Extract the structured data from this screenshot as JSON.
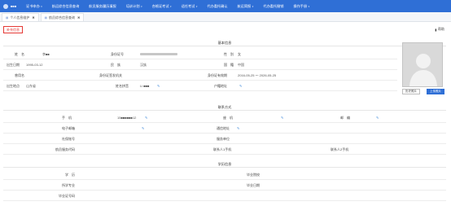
{
  "nav": {
    "brand_name": "■■■",
    "items": [
      {
        "label": "证书申办",
        "caret": "▾"
      },
      {
        "label": "航运综合信息查询",
        "caret": ""
      },
      {
        "label": "航员服务履历填报",
        "caret": ""
      },
      {
        "label": "培训计划",
        "caret": "▾"
      },
      {
        "label": "合格证考试",
        "caret": "▾"
      },
      {
        "label": "适任考试",
        "caret": "▾"
      },
      {
        "label": "代办委托确认",
        "caret": ""
      },
      {
        "label": "航运简报",
        "caret": "▾"
      },
      {
        "label": "代办委托撤销",
        "caret": ""
      },
      {
        "label": "操作手册",
        "caret": "▾"
      }
    ]
  },
  "tabs": [
    {
      "label": "个人信息维护",
      "close": "✖"
    },
    {
      "label": "航员综合信息查询",
      "close": "✖"
    }
  ],
  "toolbar": {
    "auth_label": "补充信息",
    "help_label": "帮助",
    "help_icon": "book-icon"
  },
  "basic": {
    "title": "基本信息",
    "rows": [
      [
        {
          "label": "姓　名",
          "value": "李■■"
        },
        {
          "label": "身份证号",
          "value": ""
        },
        {
          "label": "性　别",
          "value": "女"
        }
      ],
      [
        {
          "label": "出生日期",
          "value": "1995-03-12"
        },
        {
          "label": "民　族",
          "value": "汉族"
        },
        {
          "label": "国　籍",
          "value": "中国"
        }
      ],
      [
        {
          "label": "曾用名",
          "value": ""
        },
        {
          "label": "身份证签发机关",
          "value": ""
        },
        {
          "label": "身份证有效期",
          "value": "2016-05-25 ～ 2026-05-25"
        }
      ],
      [
        {
          "label": "出生地点",
          "value": "山东省"
        },
        {
          "label": "姓名拼音",
          "value": "Li ■■■"
        },
        {
          "label": "户籍地址",
          "value": ""
        }
      ]
    ]
  },
  "photo": {
    "view_label": "历史照片",
    "upload_label": "上传照片"
  },
  "contact": {
    "title": "联系方式",
    "rows": [
      [
        {
          "label": "手　机",
          "value": "15■■■■■■12"
        },
        {
          "label": "座　机",
          "value": ""
        },
        {
          "label": "邮　编",
          "value": ""
        }
      ],
      [
        {
          "label": "电子邮箱",
          "value": ""
        },
        {
          "label": "通信地址",
          "value": ""
        }
      ],
      [
        {
          "label": "社保账号",
          "value": ""
        },
        {
          "label": "服务单位",
          "value": ""
        }
      ],
      [
        {
          "label": "航员服务代码",
          "value": ""
        },
        {
          "label": "联系人1手机",
          "value": ""
        },
        {
          "label": "联系人2手机",
          "value": ""
        }
      ]
    ]
  },
  "education": {
    "title": "学历信息",
    "rows": [
      [
        {
          "label": "学　历",
          "value": ""
        },
        {
          "label": "毕业院校",
          "value": ""
        }
      ],
      [
        {
          "label": "所学专业",
          "value": ""
        },
        {
          "label": "毕业日期",
          "value": ""
        }
      ],
      [
        {
          "label": "毕业证号码",
          "value": ""
        }
      ]
    ]
  },
  "colors": {
    "nav_bg": "#2f6fd6",
    "auth_border": "#e53935",
    "edit_icon": "#3a86d9"
  }
}
